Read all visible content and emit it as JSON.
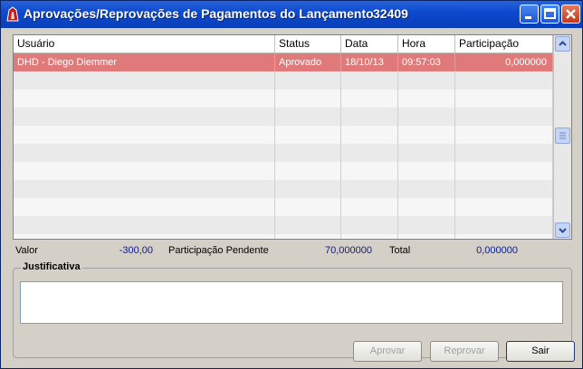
{
  "window": {
    "title": "Aprovações/Reprovações de Pagamentos do Lançamento",
    "number": "32409"
  },
  "grid": {
    "columns": [
      "Usuário",
      "Status",
      "Data",
      "Hora",
      "Participação"
    ],
    "rows": [
      {
        "usuario": "DHD  -  Diego Diemmer",
        "status": "Aprovado",
        "data": "18/10/13",
        "hora": "09:57:03",
        "participacao": "0,000000"
      }
    ]
  },
  "summary": {
    "valor_label": "Valor",
    "valor_value": "-300,00",
    "pendente_label": "Participação Pendente",
    "pendente_value": "70,000000",
    "total_label": "Total",
    "total_value": "0,000000"
  },
  "justificativa": {
    "label": "Justificativa",
    "value": ""
  },
  "buttons": {
    "aprovar": "Aprovar",
    "reprovar": "Reprovar",
    "sair": "Sair"
  }
}
